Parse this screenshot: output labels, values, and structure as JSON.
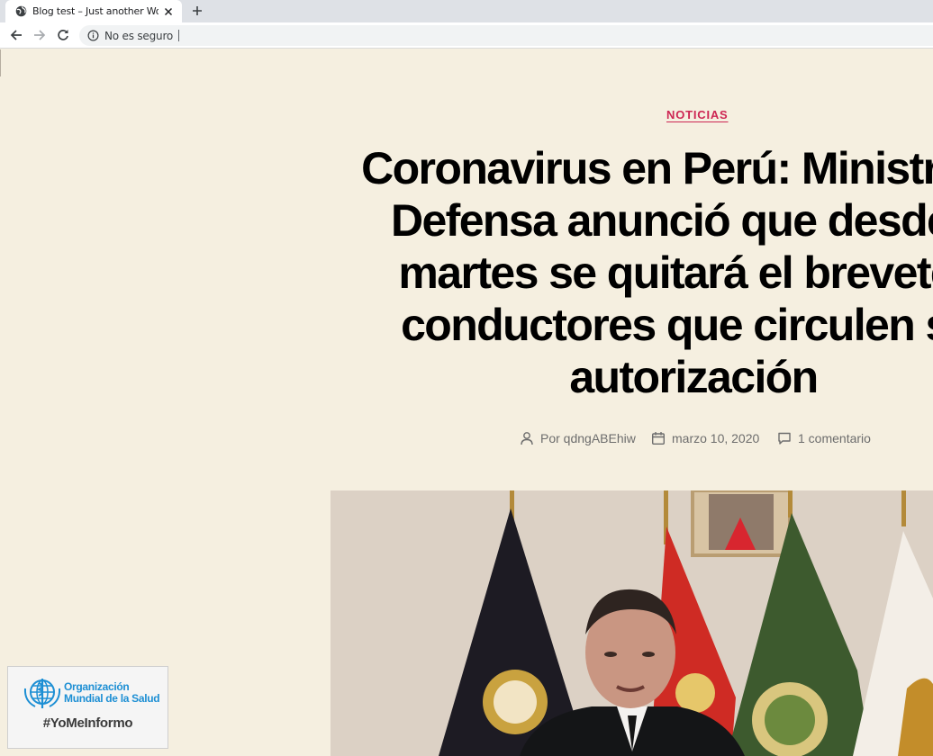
{
  "browser": {
    "tab_title": "Blog test – Just another WordPress site",
    "security_label": "No es seguro"
  },
  "article": {
    "category": "NOTICIAS",
    "headline_lines": [
      "Coronavirus en Perú: Ministro de",
      "Defensa anunció que desde el",
      "martes se quitará el brevete a",
      "conductores que circulen sin",
      "autorización"
    ],
    "author": "Por qdngABEhiw",
    "date": "marzo 10, 2020",
    "comments": "1 comentario"
  },
  "badge": {
    "org_line1": "Organización",
    "org_line2": "Mundial de la Salud",
    "hashtag": "#YoMeInformo"
  },
  "colors": {
    "accent": "#cd2653",
    "page_background": "#f5efe0",
    "who_blue": "#1d8fd4"
  },
  "icons": {
    "favicon": "wordpress-globe-icon",
    "author": "person-icon",
    "date": "calendar-icon",
    "comments": "comment-bubble-icon"
  }
}
